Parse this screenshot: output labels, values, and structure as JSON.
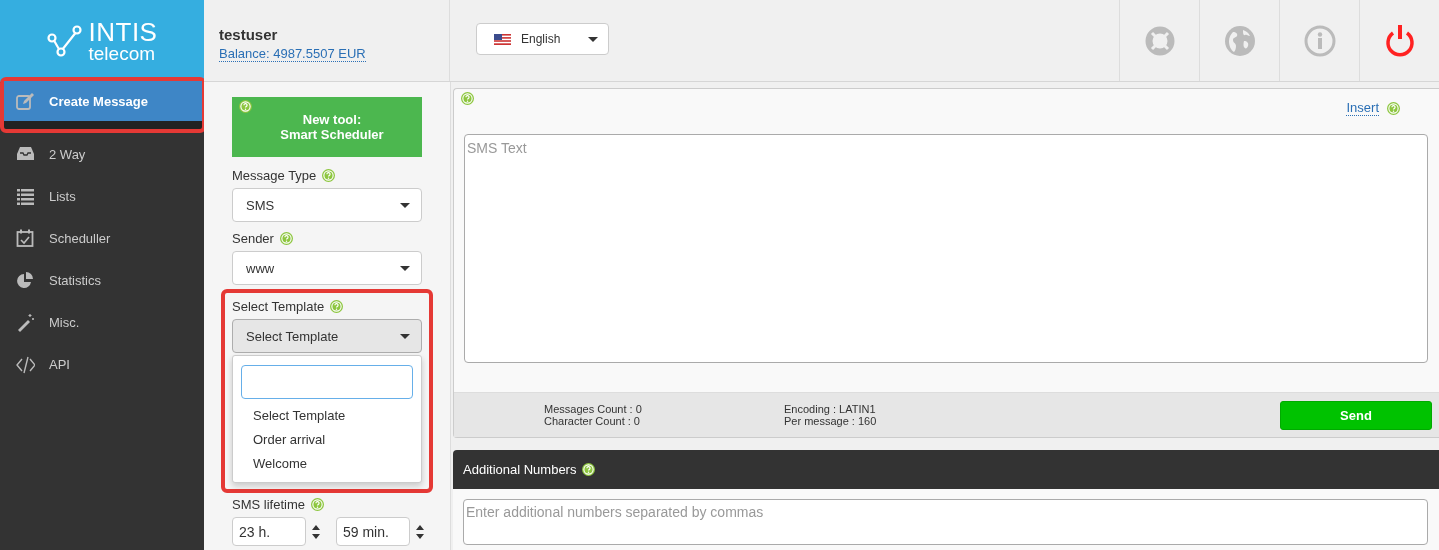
{
  "header": {
    "logo": {
      "name": "INTIS",
      "tagline": "telecom"
    },
    "user": {
      "name": "testuser",
      "balance": "Balance: 4987.5507 EUR"
    },
    "language": {
      "label": "English"
    }
  },
  "sidebar": {
    "items": [
      {
        "label": "Create Message",
        "kind": "edit",
        "selected": true,
        "highlighted": true
      },
      {
        "label": "2 Way",
        "kind": "inbox",
        "selected": false,
        "highlighted": false
      },
      {
        "label": "Lists",
        "kind": "list",
        "selected": false,
        "highlighted": false
      },
      {
        "label": "Scheduller",
        "kind": "calendar",
        "selected": false,
        "highlighted": false
      },
      {
        "label": "Statistics",
        "kind": "pie",
        "selected": false,
        "highlighted": false
      },
      {
        "label": "Misc.",
        "kind": "wand",
        "selected": false,
        "highlighted": false
      },
      {
        "label": "API",
        "kind": "code",
        "selected": false,
        "highlighted": false
      }
    ]
  },
  "form": {
    "promo": {
      "title": "New tool:",
      "subtitle": "Smart Scheduler"
    },
    "fields": [
      {
        "kind": "select",
        "label": "Message Type",
        "value": "SMS"
      },
      {
        "kind": "select",
        "label": "Sender",
        "value": "www"
      },
      {
        "kind": "template",
        "label": "Select Template",
        "value": "Select Template",
        "highlighted": true,
        "expanded": true,
        "options": [
          "Select Template",
          "Order arrival",
          "Welcome"
        ]
      }
    ],
    "lifetime": {
      "label": "SMS lifetime",
      "hours": "23 h.",
      "minutes": "59 min."
    }
  },
  "message": {
    "insert": "Insert",
    "placeholder": "SMS Text",
    "stats": [
      "Messages Count : 0",
      "Character Count : 0",
      "Encoding : LATIN1",
      "Per message : 160"
    ],
    "send": "Send"
  },
  "additional": {
    "title": "Additional Numbers",
    "placeholder": "Enter additional numbers separated by commas"
  }
}
